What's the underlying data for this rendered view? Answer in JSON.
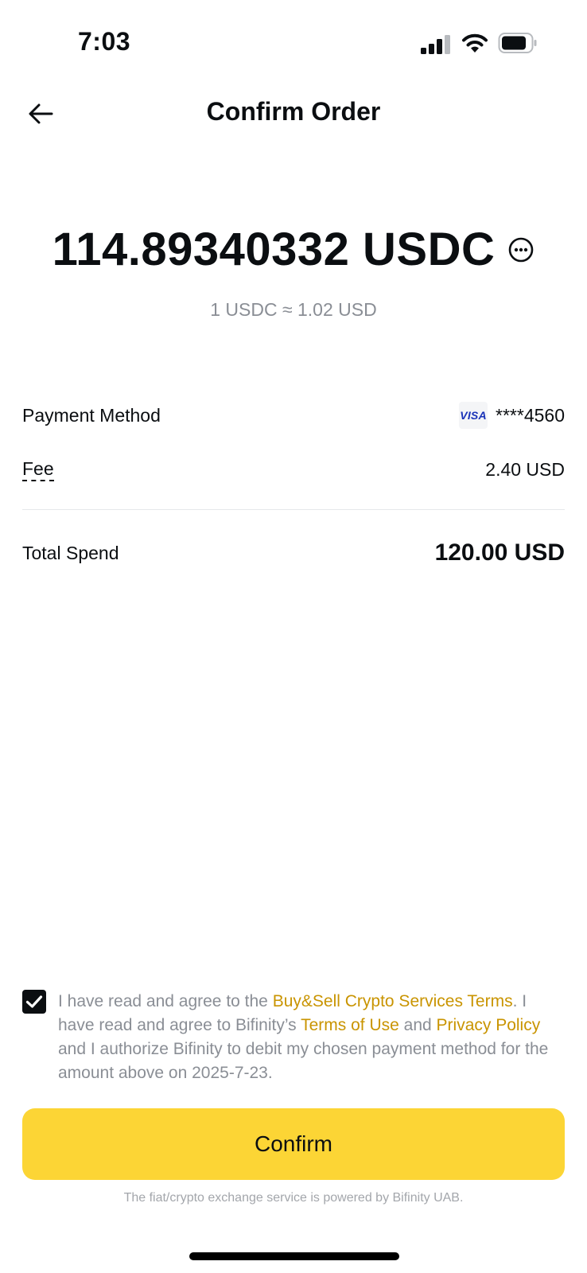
{
  "status_bar": {
    "time": "7:03",
    "icons": [
      "cellular-signal-icon",
      "wifi-icon",
      "battery-icon"
    ]
  },
  "header": {
    "title": "Confirm Order",
    "back_icon": "arrow-left-icon"
  },
  "order": {
    "amount": "114.89340332 USDC",
    "more_icon": "ellipsis-circle-icon",
    "rate": "1 USDC ≈ 1.02 USD"
  },
  "details": {
    "payment_method_label": "Payment Method",
    "card_brand": "VISA",
    "card_number": "****4560",
    "fee_label": "Fee",
    "fee_value": "2.40 USD",
    "total_label": "Total Spend",
    "total_value": "120.00 USD"
  },
  "agreement": {
    "checked": true,
    "line1_prefix": "I have read and agree to the ",
    "line1_link": "Buy&Sell Crypto Services Terms",
    "line1_suffix": ".",
    "line2_prefix": " I have read and agree to Bifinity’s ",
    "terms_link": "Terms of Use",
    "and_text": " and ",
    "privacy_link": "Privacy Policy",
    "line2_suffix": " and I authorize Bifinity to debit my chosen payment method for the amount above on 2025-7-23."
  },
  "actions": {
    "confirm_label": "Confirm"
  },
  "footer": {
    "powered_by": "The fiat/crypto exchange service is powered by Bifinity UAB."
  },
  "colors": {
    "accent": "#fcd535",
    "link": "#c99400",
    "muted_text": "#8a8e95",
    "primary_text": "#0b0e11",
    "visa_blue": "#1a33b8"
  }
}
